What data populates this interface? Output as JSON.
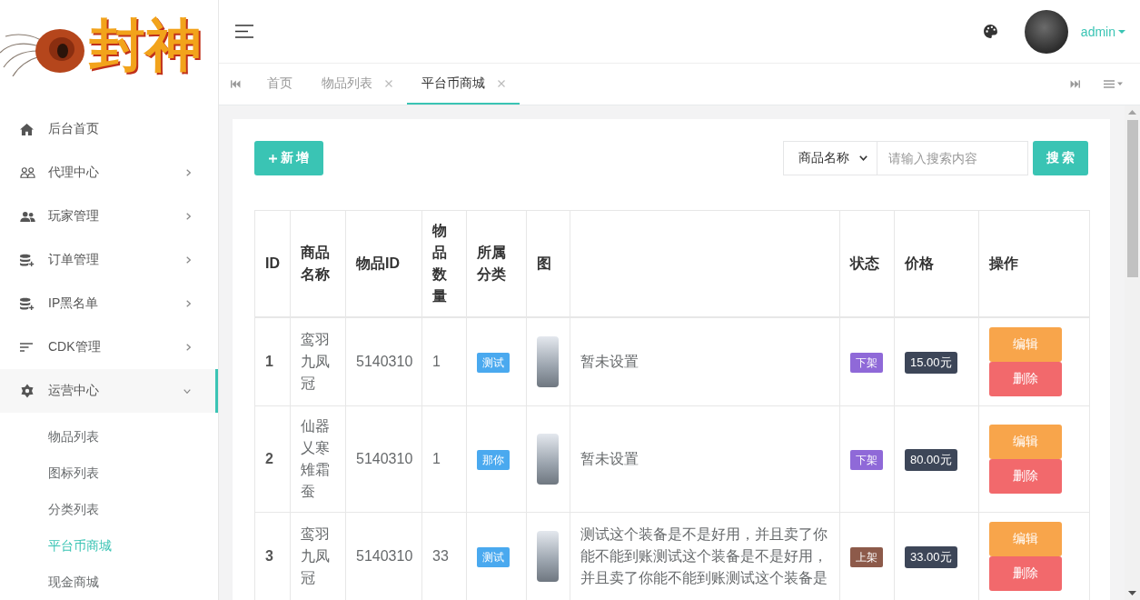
{
  "sidebar": {
    "logo_text": "封神",
    "menu": [
      {
        "label": "后台首页",
        "kind": "link"
      },
      {
        "label": "代理中心",
        "kind": "group",
        "expanded": false
      },
      {
        "label": "玩家管理",
        "kind": "group",
        "expanded": false
      },
      {
        "label": "订单管理",
        "kind": "group",
        "expanded": false
      },
      {
        "label": "IP黑名单",
        "kind": "group",
        "expanded": false
      },
      {
        "label": "CDK管理",
        "kind": "group",
        "expanded": false
      },
      {
        "label": "运营中心",
        "kind": "group",
        "expanded": true,
        "children": [
          {
            "label": "物品列表",
            "selected": false
          },
          {
            "label": "图标列表",
            "selected": false
          },
          {
            "label": "分类列表",
            "selected": false
          },
          {
            "label": "平台币商城",
            "selected": true
          },
          {
            "label": "现金商城",
            "selected": false
          }
        ]
      }
    ]
  },
  "header": {
    "user": {
      "name": "admin"
    }
  },
  "tabs": [
    {
      "label": "首页",
      "selected": false,
      "closable": false
    },
    {
      "label": "物品列表",
      "selected": false,
      "closable": true
    },
    {
      "label": "平台币商城",
      "selected": true,
      "closable": true
    }
  ],
  "toolbar": {
    "add_button": "新 增",
    "search_by": {
      "value": "商品名称"
    },
    "search_input": {
      "placeholder": "请输入搜索内容"
    },
    "search_button": "搜 索"
  },
  "table": {
    "columns": [
      "ID",
      "商品名称",
      "物品ID",
      "物品数量",
      "所属分类",
      "图",
      null,
      "状态",
      "价格",
      "操作"
    ],
    "rows": [
      {
        "id": "1",
        "name": "鸾羽九凤冠",
        "item_id": "5140310",
        "quantity": "1",
        "category": "测试",
        "description": "暂未设置",
        "status": {
          "label": "下架",
          "color": "#8f69d8"
        },
        "price": "15.00元",
        "actions": [
          {
            "label": "编辑",
            "kind": "edit"
          },
          {
            "label": "删除",
            "kind": "delete"
          }
        ]
      },
      {
        "id": "2",
        "name": "仙器乂寒雉霜蚕",
        "item_id": "5140310",
        "quantity": "1",
        "category": "那你",
        "description": "暂未设置",
        "status": {
          "label": "下架",
          "color": "#8f69d8"
        },
        "price": "80.00元",
        "actions": [
          {
            "label": "编辑",
            "kind": "edit"
          },
          {
            "label": "删除",
            "kind": "delete"
          }
        ]
      },
      {
        "id": "3",
        "name": "鸾羽九凤冠",
        "item_id": "5140310",
        "quantity": "33",
        "category": "测试",
        "description": "测试这个装备是不是好用，并且卖了你能不能到账测试这个装备是不是好用，并且卖了你能不能到账测试这个装备是",
        "status": {
          "label": "上架",
          "color": "#8d5a4a"
        },
        "price": "33.00元",
        "actions": [
          {
            "label": "编辑",
            "kind": "edit"
          },
          {
            "label": "删除",
            "kind": "delete"
          }
        ]
      }
    ]
  }
}
